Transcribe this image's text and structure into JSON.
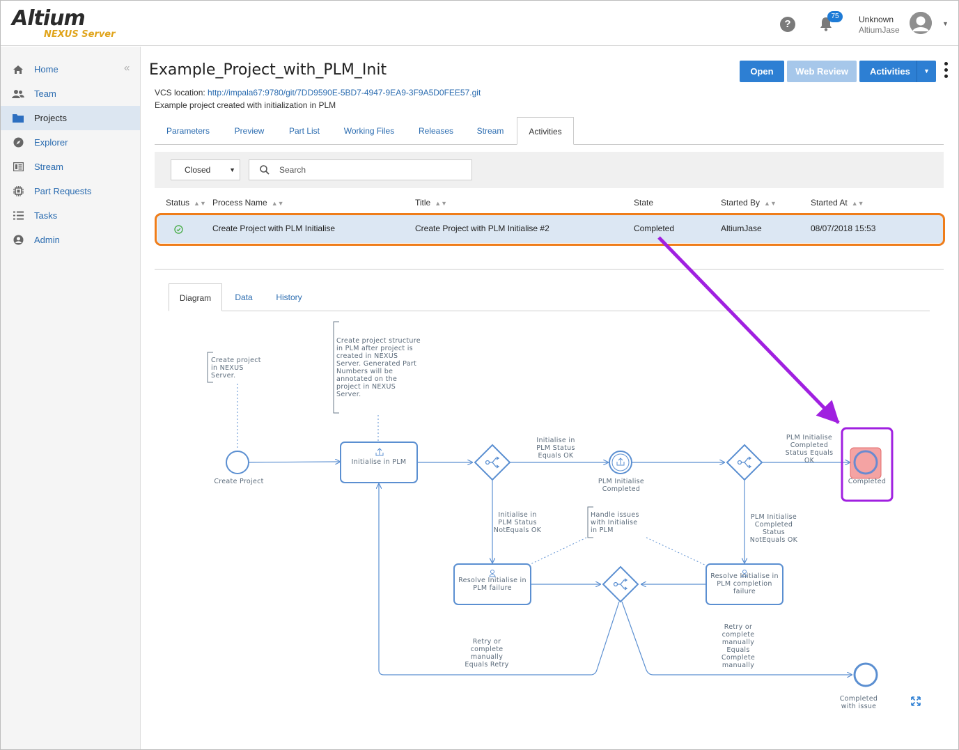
{
  "header": {
    "logo_main": "Altium",
    "logo_sub": "NEXUS Server",
    "help_icon": "?",
    "notifications_count": "75",
    "user_name": "Unknown",
    "user_login": "AltiumJase"
  },
  "sidebar": {
    "items": [
      {
        "label": "Home",
        "icon": "home-icon"
      },
      {
        "label": "Team",
        "icon": "team-icon"
      },
      {
        "label": "Projects",
        "icon": "folder-icon"
      },
      {
        "label": "Explorer",
        "icon": "compass-icon"
      },
      {
        "label": "Stream",
        "icon": "stream-icon"
      },
      {
        "label": "Part Requests",
        "icon": "chip-icon"
      },
      {
        "label": "Tasks",
        "icon": "tasks-icon"
      },
      {
        "label": "Admin",
        "icon": "admin-icon"
      }
    ]
  },
  "project": {
    "title": "Example_Project_with_PLM_Init",
    "vcs_label": "VCS location:",
    "vcs_url": "http://impala67:9780/git/7DD9590E-5BD7-4947-9EA9-3F9A5D0FEE57.git",
    "description": "Example project created with initialization in PLM"
  },
  "actions": {
    "open": "Open",
    "web_review": "Web Review",
    "activities": "Activities"
  },
  "tabs": [
    "Parameters",
    "Preview",
    "Part List",
    "Working Files",
    "Releases",
    "Stream",
    "Activities"
  ],
  "filter": {
    "selected": "Closed",
    "search_placeholder": "Search"
  },
  "table": {
    "columns": [
      "Status",
      "Process Name",
      "Title",
      "State",
      "Started By",
      "Started At"
    ],
    "rows": [
      {
        "status": "completed",
        "process_name": "Create Project with PLM Initialise",
        "title": "Create Project with PLM Initialise #2",
        "state": "Completed",
        "started_by": "AltiumJase",
        "started_at": "08/07/2018 15:53"
      }
    ]
  },
  "detail_tabs": [
    "Diagram",
    "Data",
    "History"
  ],
  "diagram": {
    "annotations": {
      "create_project_note": [
        "Create project",
        "in NEXUS",
        "Server."
      ],
      "plm_note": [
        "Create project structure",
        "in PLM after project is",
        "created in NEXUS",
        "Server. Generated Part",
        "Numbers will be",
        "annotated on the",
        "project in NEXUS",
        "Server."
      ],
      "handle_note": [
        "Handle issues",
        "with Initialise",
        "in PLM"
      ]
    },
    "nodes": {
      "create_project": "Create Project",
      "initialise_plm": "Initialise in PLM",
      "plm_initialise_completed": [
        "PLM Initialise",
        "Completed"
      ],
      "completed": "Completed",
      "resolve_init": [
        "Resolve Initialise in",
        "PLM failure"
      ],
      "resolve_completion": [
        "Resolve Initialise in",
        "PLM completion",
        "failure"
      ],
      "completed_with_issue": [
        "Completed",
        "with issue"
      ]
    },
    "edges": {
      "status_ok": [
        "Initialise in",
        "PLM Status",
        "Equals OK"
      ],
      "status_not_ok": [
        "Initialise in",
        "PLM Status",
        "NotEquals OK"
      ],
      "completed_ok": [
        "PLM Initialise",
        "Completed",
        "Status Equals",
        "OK"
      ],
      "completed_not_ok": [
        "PLM Initialise",
        "Completed",
        "Status",
        "NotEquals OK"
      ],
      "retry": [
        "Retry or",
        "complete",
        "manually",
        "Equals Retry"
      ],
      "complete_manually": [
        "Retry or",
        "complete",
        "manually",
        "Equals",
        "Complete",
        "manually"
      ]
    }
  },
  "colors": {
    "accent": "#2d7fd3",
    "highlight_row": "#ef7d1a",
    "highlight_node": "#a020e0",
    "diagram_stroke": "#5b8fd1",
    "completed_fill": "#f4a3a3"
  }
}
